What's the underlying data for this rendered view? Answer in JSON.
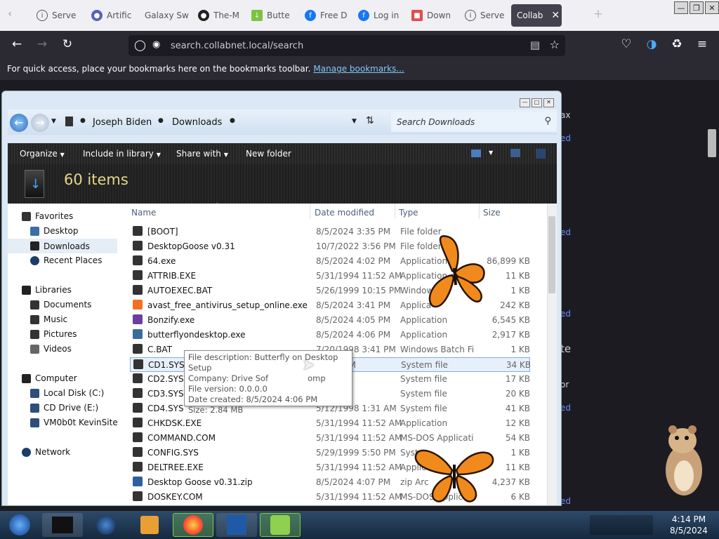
{
  "browser": {
    "tabs": [
      {
        "label": "Serve",
        "icon": "info-icon"
      },
      {
        "label": "Artific",
        "icon": "globe-icon"
      },
      {
        "label": "Galaxy Sw",
        "icon": "none"
      },
      {
        "label": "The-M",
        "icon": "github-icon"
      },
      {
        "label": "Butte",
        "icon": "download-icon"
      },
      {
        "label": "Free D",
        "icon": "facebook-icon"
      },
      {
        "label": "Log in",
        "icon": "facebook-icon"
      },
      {
        "label": "Down",
        "icon": "calendar-icon"
      },
      {
        "label": "Serve",
        "icon": "info-icon"
      },
      {
        "label": "Collab",
        "icon": "none",
        "active": true
      }
    ],
    "new_tab_label": "+",
    "url": "search.collabnet.local/search",
    "bookmarks_message": "For quick access, place your bookmarks here on the bookmarks toolbar.",
    "manage_bookmarks_label": "Manage bookmarks..."
  },
  "page_behind": {
    "fragments": [
      {
        "text": "ax",
        "kind": "text"
      },
      {
        "text": "ed",
        "kind": "link"
      },
      {
        "text": "ed",
        "kind": "link"
      },
      {
        "text": "ed",
        "kind": "link"
      },
      {
        "text": "te",
        "kind": "text"
      },
      {
        "text": "or",
        "kind": "text"
      },
      {
        "text": "ed",
        "kind": "link"
      },
      {
        "text": "ed",
        "kind": "link"
      }
    ]
  },
  "explorer": {
    "breadcrumb": [
      "Joseph Biden",
      "Downloads"
    ],
    "search_placeholder": "Search Downloads",
    "commands": [
      "Organize",
      "Include in library",
      "Share with",
      "New folder"
    ],
    "item_count": "60 items",
    "nav": {
      "favorites_label": "Favorites",
      "favorites": [
        "Desktop",
        "Downloads",
        "Recent Places"
      ],
      "libraries_label": "Libraries",
      "libraries": [
        "Documents",
        "Music",
        "Pictures",
        "Videos"
      ],
      "computer_label": "Computer",
      "computer": [
        "Local Disk (C:)",
        "CD Drive (E:)",
        "VM0b0t KevinSite"
      ],
      "network_label": "Network"
    },
    "columns": [
      "Name",
      "Date modified",
      "Type",
      "Size"
    ],
    "files": [
      {
        "name": "[BOOT]",
        "date": "8/5/2024 3:35 PM",
        "type": "File folder",
        "size": ""
      },
      {
        "name": "DesktopGoose v0.31",
        "date": "10/7/2022 3:56 PM",
        "type": "File folder",
        "size": ""
      },
      {
        "name": "64.exe",
        "date": "8/5/2024 4:02 PM",
        "type": "Application",
        "size": "86,899 KB"
      },
      {
        "name": "ATTRIB.EXE",
        "date": "5/31/1994 11:52 AM",
        "type": "Application",
        "size": "11 KB"
      },
      {
        "name": "AUTOEXEC.BAT",
        "date": "5/26/1999 10:15 PM",
        "type": "Windows",
        "size": "1 KB"
      },
      {
        "name": "avast_free_antivirus_setup_online.exe",
        "date": "8/5/2024 3:41 PM",
        "type": "Applica",
        "size": "242 KB"
      },
      {
        "name": "Bonzify.exe",
        "date": "8/5/2024 4:05 PM",
        "type": "Application",
        "size": "6,545 KB"
      },
      {
        "name": "butterflyondesktop.exe",
        "date": "8/5/2024 4:06 PM",
        "type": "Application",
        "size": "2,917 KB"
      },
      {
        "name": "C.BAT",
        "date": "7/20/1998 3:41 PM",
        "type": "Windows Batch File",
        "size": "1 KB"
      },
      {
        "name": "CD1.SYS",
        "date": "10:43 PM",
        "type": "System file",
        "size": "34 KB"
      },
      {
        "name": "CD2.SYS",
        "date": "7:24 AM",
        "type": "System file",
        "size": "17 KB"
      },
      {
        "name": "CD3.SYS",
        "date": "6:33 AM",
        "type": "System file",
        "size": "20 KB"
      },
      {
        "name": "CD4.SYS",
        "date": "5/12/1998 1:31 AM",
        "type": "System file",
        "size": "41 KB"
      },
      {
        "name": "CHKDSK.EXE",
        "date": "5/31/1994 11:52 AM",
        "type": "Application",
        "size": "12 KB"
      },
      {
        "name": "COMMAND.COM",
        "date": "5/31/1994 11:52 AM",
        "type": "MS-DOS Applicati...",
        "size": "54 KB"
      },
      {
        "name": "CONFIG.SYS",
        "date": "5/29/1999 5:50 PM",
        "type": "Syste",
        "size": "1 KB"
      },
      {
        "name": "DELTREE.EXE",
        "date": "5/31/1994 11:52 AM",
        "type": "Applic",
        "size": "11 KB"
      },
      {
        "name": "Desktop Goose v0.31.zip",
        "date": "8/5/2024 4:07 PM",
        "type": "zip Arc",
        "size": "4,237 KB"
      },
      {
        "name": "DOSKEY.COM",
        "date": "5/31/1994 11:52 AM",
        "type": "MS-DOS Applic",
        "size": "6 KB"
      }
    ],
    "tooltip": {
      "description": "File description: Butterfly on Desktop Setup",
      "company": "Company: Drive Sof",
      "company_tail": "omp",
      "version": "File version: 0.0.0.0",
      "created": "Date created: 8/5/2024 4:06 PM",
      "size": "Size: 2.84 MB"
    }
  },
  "taskbar": {
    "apps": [
      "start-orb-icon",
      "terminal-icon",
      "globe-icon",
      "media-player-icon",
      "firefox-icon",
      "virtualbox-icon",
      "pen-icon"
    ],
    "time": "4:14 PM",
    "date": "8/5/2024"
  },
  "colors": {
    "accent": "#42414d",
    "link": "#6c8cf4",
    "item_count": "#e7d58a"
  }
}
